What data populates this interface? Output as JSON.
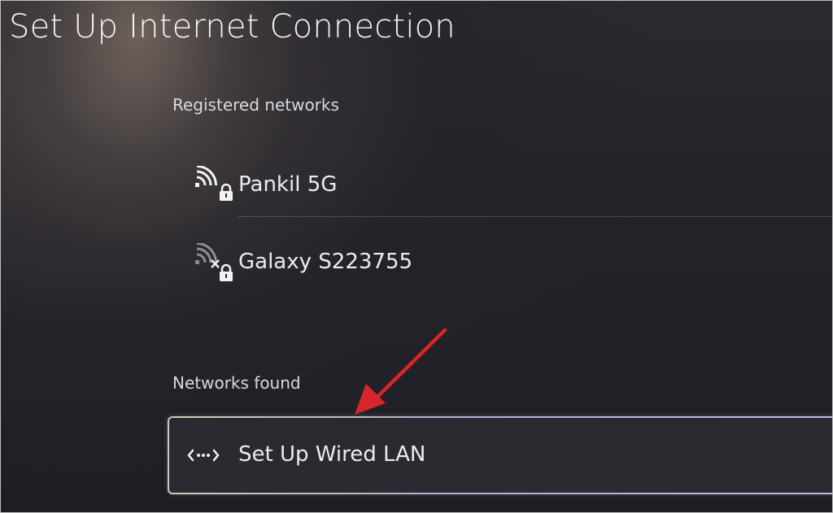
{
  "header": {
    "title": "Set Up Internet Connection"
  },
  "registered": {
    "label": "Registered networks",
    "items": [
      {
        "name": "Pankil 5G",
        "icon": "wifi-locked-icon"
      },
      {
        "name": "Galaxy S223755",
        "icon": "wifi-unavailable-locked-icon"
      }
    ]
  },
  "found": {
    "label": "Networks found",
    "items": [
      {
        "name": "Set Up Wired LAN",
        "icon": "wired-lan-icon"
      }
    ]
  },
  "annotation": {
    "type": "arrow",
    "color": "#d7262b"
  },
  "colors": {
    "text": "#ececf0",
    "focus_border": "#c7b6e0",
    "background": "#232228"
  }
}
